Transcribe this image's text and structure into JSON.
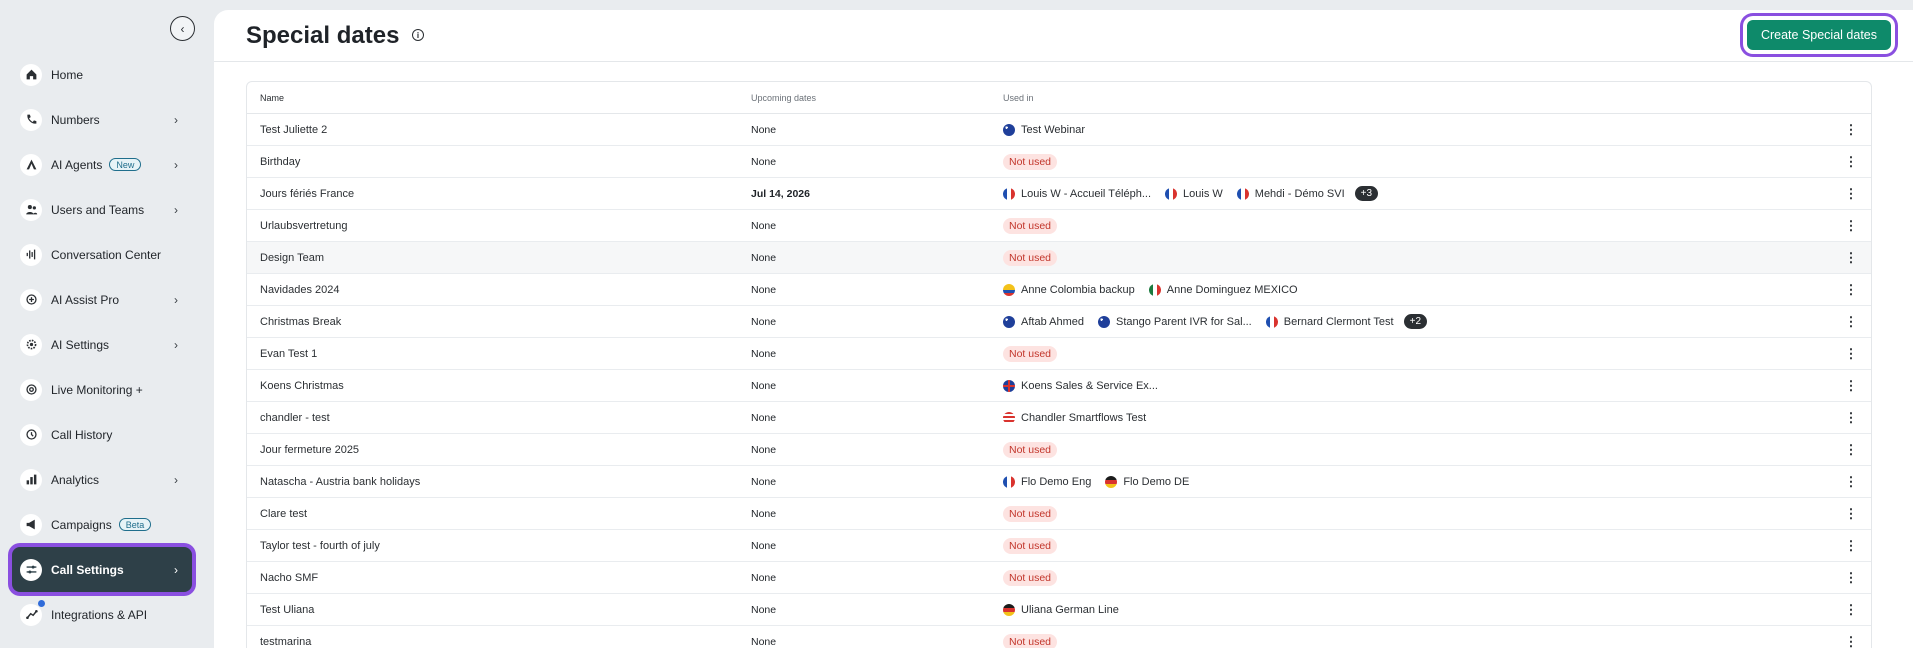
{
  "sidebar": {
    "collapse_glyph": "‹",
    "items": [
      {
        "label": "Home",
        "icon": "home-icon",
        "chevron": ""
      },
      {
        "label": "Numbers",
        "icon": "phone-icon",
        "chevron": "›"
      },
      {
        "label": "AI Agents",
        "icon": "ai-agent-icon",
        "chevron": "›",
        "badge": "New"
      },
      {
        "label": "Users and Teams",
        "icon": "users-icon",
        "chevron": "›"
      },
      {
        "label": "Conversation Center",
        "icon": "waveform-icon",
        "chevron": ""
      },
      {
        "label": "AI Assist Pro",
        "icon": "assist-icon",
        "chevron": "›"
      },
      {
        "label": "AI Settings",
        "icon": "ai-settings-icon",
        "chevron": "›"
      },
      {
        "label": "Live Monitoring +",
        "icon": "monitor-icon",
        "chevron": ""
      },
      {
        "label": "Call History",
        "icon": "history-icon",
        "chevron": ""
      },
      {
        "label": "Analytics",
        "icon": "analytics-icon",
        "chevron": "›"
      },
      {
        "label": "Campaigns",
        "icon": "megaphone-icon",
        "chevron": "",
        "badge": "Beta"
      },
      {
        "label": "Call Settings",
        "icon": "sliders-icon",
        "chevron": "›",
        "active": true
      },
      {
        "label": "Integrations & API",
        "icon": "integrations-icon",
        "chevron": ""
      }
    ]
  },
  "header": {
    "title": "Special dates",
    "info_glyph": "i",
    "create_label": "Create Special dates"
  },
  "table": {
    "columns": {
      "name": "Name",
      "upcoming": "Upcoming dates",
      "used_in": "Used in"
    },
    "menu_glyph": "⋮",
    "not_used_label": "Not used",
    "rows": [
      {
        "name": "Test Juliette 2",
        "upcoming": "None",
        "used": [
          {
            "flag": "au",
            "label": "Test Webinar"
          }
        ]
      },
      {
        "name": "Birthday",
        "upcoming": "None",
        "used": []
      },
      {
        "name": "Jours fériés France",
        "upcoming": "Jul 14, 2026",
        "used": [
          {
            "flag": "fr",
            "label": "Louis W - Accueil Téléph..."
          },
          {
            "flag": "fr",
            "label": "Louis W"
          },
          {
            "flag": "fr",
            "label": "Mehdi - Démo SVI"
          }
        ],
        "more": "+3"
      },
      {
        "name": "Urlaubsvertretung",
        "upcoming": "None",
        "used": []
      },
      {
        "name": "Design Team",
        "upcoming": "None",
        "used": [],
        "highlight": true
      },
      {
        "name": "Navidades 2024",
        "upcoming": "None",
        "used": [
          {
            "flag": "co",
            "label": "Anne Colombia backup"
          },
          {
            "flag": "mx",
            "label": "Anne Dominguez MEXICO"
          }
        ]
      },
      {
        "name": "Christmas Break",
        "upcoming": "None",
        "used": [
          {
            "flag": "au",
            "label": "Aftab Ahmed"
          },
          {
            "flag": "au",
            "label": "Stango Parent IVR for Sal..."
          },
          {
            "flag": "fr",
            "label": "Bernard Clermont Test"
          }
        ],
        "more": "+2"
      },
      {
        "name": "Evan Test 1",
        "upcoming": "None",
        "used": []
      },
      {
        "name": "Koens Christmas",
        "upcoming": "None",
        "used": [
          {
            "flag": "gb",
            "label": "Koens Sales & Service Ex..."
          }
        ]
      },
      {
        "name": "chandler - test",
        "upcoming": "None",
        "used": [
          {
            "flag": "us",
            "label": "Chandler Smartflows Test"
          }
        ]
      },
      {
        "name": "Jour fermeture 2025",
        "upcoming": "None",
        "used": []
      },
      {
        "name": "Natascha - Austria bank holidays",
        "upcoming": "None",
        "used": [
          {
            "flag": "fr",
            "label": "Flo Demo Eng"
          },
          {
            "flag": "de",
            "label": "Flo Demo DE"
          }
        ]
      },
      {
        "name": "Clare test",
        "upcoming": "None",
        "used": []
      },
      {
        "name": "Taylor test - fourth of july",
        "upcoming": "None",
        "used": []
      },
      {
        "name": "Nacho SMF",
        "upcoming": "None",
        "used": []
      },
      {
        "name": "Test Uliana",
        "upcoming": "None",
        "used": [
          {
            "flag": "de",
            "label": "Uliana German Line"
          }
        ]
      },
      {
        "name": "testmarina",
        "upcoming": "None",
        "used": []
      }
    ]
  },
  "colors": {
    "accent": "#0e8a6a",
    "focus_ring": "#8a4fe0",
    "active_nav": "#2e4048",
    "not_used_bg": "#fde3e1",
    "not_used_text": "#c2362b"
  }
}
